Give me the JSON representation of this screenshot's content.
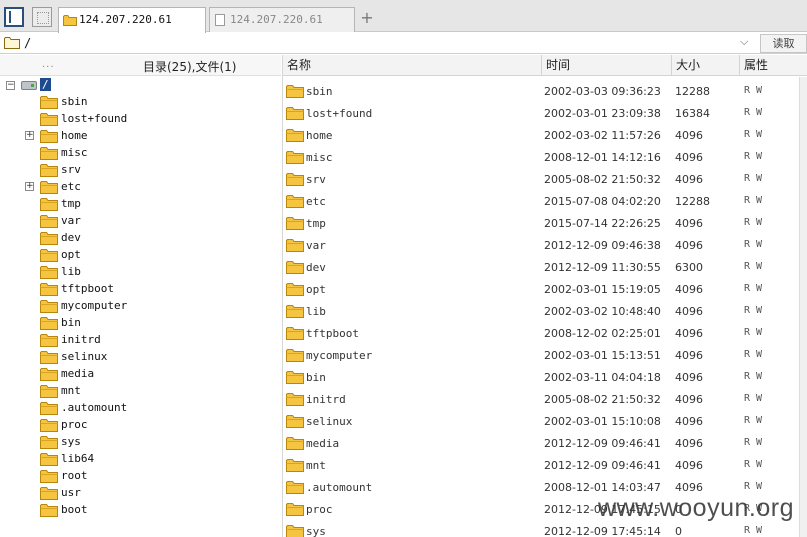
{
  "tabs": [
    {
      "label": "124.207.220.61",
      "active": true
    },
    {
      "label": "124.207.220.61",
      "active": false
    }
  ],
  "newtab_glyph": "+",
  "address": {
    "path": "/",
    "read_button": "读取"
  },
  "left_pane": {
    "dots": "...",
    "summary": "目录(25),文件(1)",
    "root": {
      "label": "/",
      "expander": "−",
      "icon": "drive-icon"
    },
    "tree": [
      {
        "name": "sbin",
        "expandable": false
      },
      {
        "name": "lost+found",
        "expandable": false
      },
      {
        "name": "home",
        "expandable": true
      },
      {
        "name": "misc",
        "expandable": false
      },
      {
        "name": "srv",
        "expandable": false
      },
      {
        "name": "etc",
        "expandable": true
      },
      {
        "name": "tmp",
        "expandable": false
      },
      {
        "name": "var",
        "expandable": false
      },
      {
        "name": "dev",
        "expandable": false
      },
      {
        "name": "opt",
        "expandable": false
      },
      {
        "name": "lib",
        "expandable": false
      },
      {
        "name": "tftpboot",
        "expandable": false
      },
      {
        "name": "mycomputer",
        "expandable": false
      },
      {
        "name": "bin",
        "expandable": false
      },
      {
        "name": "initrd",
        "expandable": false
      },
      {
        "name": "selinux",
        "expandable": false
      },
      {
        "name": "media",
        "expandable": false
      },
      {
        "name": "mnt",
        "expandable": false
      },
      {
        "name": ".automount",
        "expandable": false
      },
      {
        "name": "proc",
        "expandable": false
      },
      {
        "name": "sys",
        "expandable": false
      },
      {
        "name": "lib64",
        "expandable": false
      },
      {
        "name": "root",
        "expandable": false
      },
      {
        "name": "usr",
        "expandable": false
      },
      {
        "name": "boot",
        "expandable": false
      }
    ]
  },
  "right_pane": {
    "columns": {
      "name": "名称",
      "time": "时间",
      "size": "大小",
      "attr": "属性"
    },
    "files": [
      {
        "name": "sbin",
        "time": "2002-03-03 09:36:23",
        "size": "12288",
        "attr": "R W"
      },
      {
        "name": "lost+found",
        "time": "2002-03-01 23:09:38",
        "size": "16384",
        "attr": "R W"
      },
      {
        "name": "home",
        "time": "2002-03-02 11:57:26",
        "size": "4096",
        "attr": "R W"
      },
      {
        "name": "misc",
        "time": "2008-12-01 14:12:16",
        "size": "4096",
        "attr": "R W"
      },
      {
        "name": "srv",
        "time": "2005-08-02 21:50:32",
        "size": "4096",
        "attr": "R W"
      },
      {
        "name": "etc",
        "time": "2015-07-08 04:02:20",
        "size": "12288",
        "attr": "R W"
      },
      {
        "name": "tmp",
        "time": "2015-07-14 22:26:25",
        "size": "4096",
        "attr": "R W"
      },
      {
        "name": "var",
        "time": "2012-12-09 09:46:38",
        "size": "4096",
        "attr": "R W"
      },
      {
        "name": "dev",
        "time": "2012-12-09 11:30:55",
        "size": "6300",
        "attr": "R W"
      },
      {
        "name": "opt",
        "time": "2002-03-01 15:19:05",
        "size": "4096",
        "attr": "R W"
      },
      {
        "name": "lib",
        "time": "2002-03-02 10:48:40",
        "size": "4096",
        "attr": "R W"
      },
      {
        "name": "tftpboot",
        "time": "2008-12-02 02:25:01",
        "size": "4096",
        "attr": "R W"
      },
      {
        "name": "mycomputer",
        "time": "2002-03-01 15:13:51",
        "size": "4096",
        "attr": "R W"
      },
      {
        "name": "bin",
        "time": "2002-03-11 04:04:18",
        "size": "4096",
        "attr": "R W"
      },
      {
        "name": "initrd",
        "time": "2005-08-02 21:50:32",
        "size": "4096",
        "attr": "R W"
      },
      {
        "name": "selinux",
        "time": "2002-03-01 15:10:08",
        "size": "4096",
        "attr": "R W"
      },
      {
        "name": "media",
        "time": "2012-12-09 09:46:41",
        "size": "4096",
        "attr": "R W"
      },
      {
        "name": "mnt",
        "time": "2012-12-09 09:46:41",
        "size": "4096",
        "attr": "R W"
      },
      {
        "name": ".automount",
        "time": "2008-12-01 14:03:47",
        "size": "4096",
        "attr": "R W"
      },
      {
        "name": "proc",
        "time": "2012-12-09 17:45:15",
        "size": "0",
        "attr": "R W"
      },
      {
        "name": "sys",
        "time": "2012-12-09 17:45:14",
        "size": "0",
        "attr": "R W"
      }
    ]
  },
  "watermark": "www.wooyun.org",
  "colors": {
    "folder": "#f5c542",
    "folder_edge": "#b8860b",
    "selection": "#1d4b8f"
  }
}
